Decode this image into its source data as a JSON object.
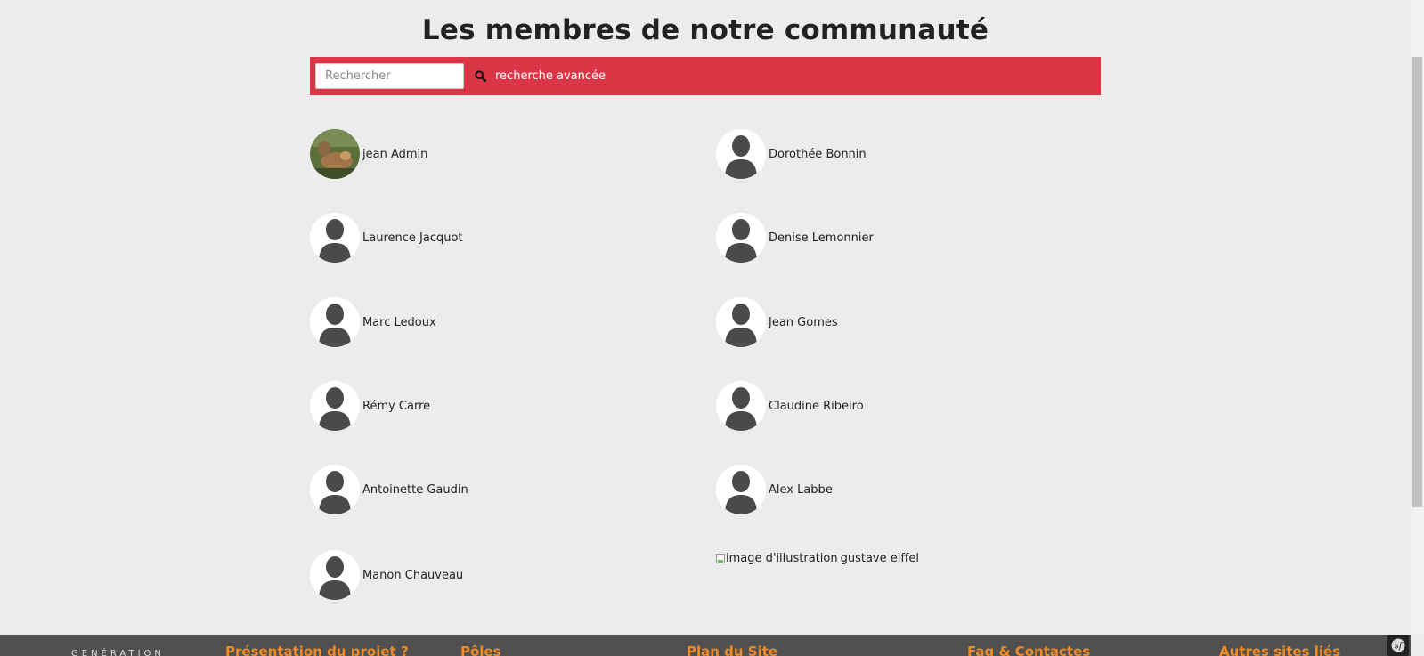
{
  "page": {
    "title": "Les membres de notre communauté"
  },
  "search": {
    "placeholder": "Rechercher",
    "advanced_label": "recherche avancée"
  },
  "members": [
    {
      "name": "jean Admin",
      "avatar": "photo"
    },
    {
      "name": "Dorothée Bonnin",
      "avatar": "default"
    },
    {
      "name": "Laurence Jacquot",
      "avatar": "default"
    },
    {
      "name": "Denise Lemonnier",
      "avatar": "default"
    },
    {
      "name": "Marc Ledoux",
      "avatar": "default"
    },
    {
      "name": "Jean Gomes",
      "avatar": "default"
    },
    {
      "name": "Rémy Carre",
      "avatar": "default"
    },
    {
      "name": "Claudine Ribeiro",
      "avatar": "default"
    },
    {
      "name": "Antoinette Gaudin",
      "avatar": "default"
    },
    {
      "name": "Alex Labbe",
      "avatar": "default"
    },
    {
      "name": "Manon Chauveau",
      "avatar": "default"
    },
    {
      "name": "gustave eiffel",
      "avatar": "broken",
      "alt": "image d'illustration"
    }
  ],
  "footer": {
    "brand": "GÉNÉRATION",
    "links": [
      "Présentation du projet ?",
      "Pôles",
      "Plan du Site",
      "Faq & Contactes",
      "Autres sites liés"
    ]
  },
  "colors": {
    "accent": "#dc3545",
    "footer_bg": "#505050",
    "footer_link": "#f08a24"
  }
}
